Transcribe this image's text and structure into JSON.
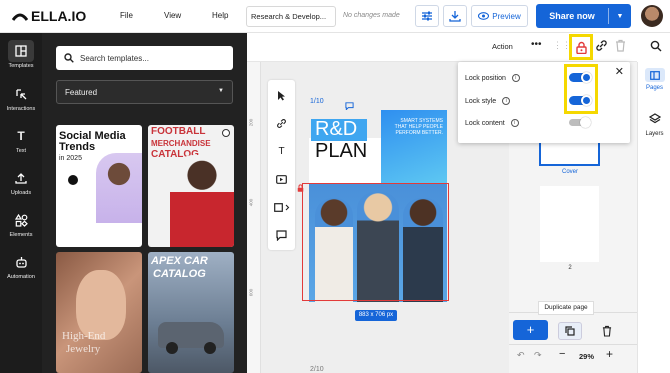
{
  "app": {
    "brand": "ELLA.IO"
  },
  "menu": [
    "File",
    "View",
    "Help"
  ],
  "document": {
    "title": "Research & Develop...",
    "status": "No changes made"
  },
  "toolbar": {
    "preview_label": "Preview",
    "share_label": "Share now"
  },
  "colors": {
    "accent": "#1565d8",
    "highlight": "#f5d800",
    "rail_bg": "#1c1c1c",
    "panel_bg": "#222222",
    "lock_red": "#e23a3a"
  },
  "left_rail": [
    {
      "label": "Templates",
      "icon": "layout-icon"
    },
    {
      "label": "Interactions",
      "icon": "interactions-icon"
    },
    {
      "label": "Text",
      "icon": "text-icon"
    },
    {
      "label": "Uploads",
      "icon": "upload-icon"
    },
    {
      "label": "Elements",
      "icon": "elements-icon"
    },
    {
      "label": "Automation",
      "icon": "automation-icon"
    }
  ],
  "templates_panel": {
    "search_placeholder": "Search templates...",
    "filter_value": "Featured",
    "cards": [
      {
        "title_line1": "Social Media",
        "title_line2": "Trends",
        "title_line3": "in 2025"
      },
      {
        "title_line1": "FOOTBALL",
        "title_line2": "MERCHANDISE",
        "title_line3": "CATALOG"
      },
      {
        "title_line1": "High-End",
        "title_line2": "Jewelry"
      },
      {
        "title_line1": "APEX CAR",
        "title_line2": "CATALOG"
      }
    ]
  },
  "canvas": {
    "page_indicator": "1/10",
    "page_indicator_2": "2/10",
    "ruler_marks": [
      "200",
      "400",
      "600"
    ],
    "design": {
      "title_line1": "R&D",
      "title_line2": "PLAN",
      "tagline": "SMART SYSTEMS THAT HELP PEOPLE PERFORM BETTER."
    },
    "selection_size": "883 x 706 px"
  },
  "property_bar": {
    "action_label": "Action"
  },
  "lock_popup": {
    "rows": [
      {
        "label": "Lock position",
        "on": true
      },
      {
        "label": "Lock style",
        "on": true
      },
      {
        "label": "Lock content",
        "on": false
      }
    ]
  },
  "pages_panel": {
    "pages": [
      {
        "label": "Cover"
      },
      {
        "label": "2"
      }
    ],
    "tooltip": "Duplicate page",
    "zoom": "29%"
  },
  "right_rail": [
    {
      "label": "Pages"
    },
    {
      "label": "Layers"
    }
  ]
}
